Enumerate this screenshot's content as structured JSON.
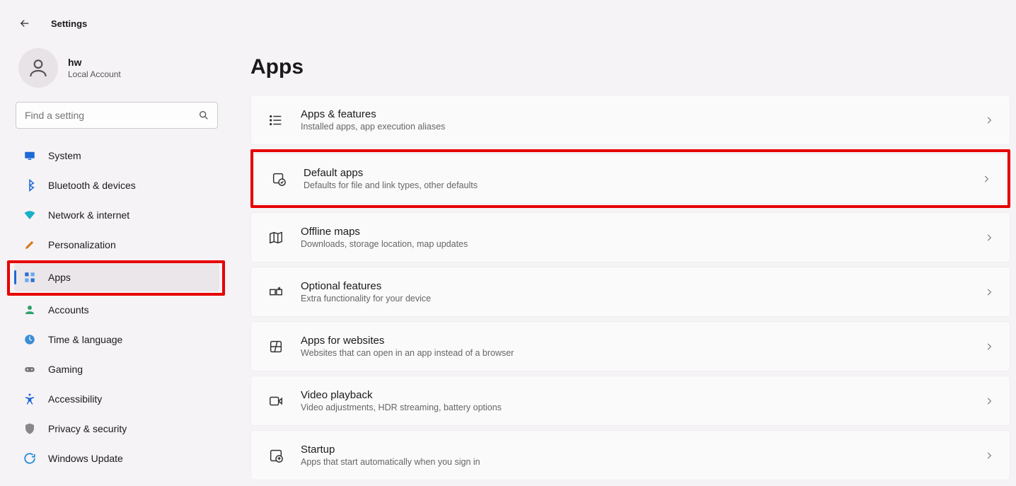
{
  "header": {
    "title": "Settings"
  },
  "user": {
    "name": "hw",
    "subtitle": "Local Account"
  },
  "search": {
    "placeholder": "Find a setting"
  },
  "nav": {
    "items": [
      {
        "label": "System"
      },
      {
        "label": "Bluetooth & devices"
      },
      {
        "label": "Network & internet"
      },
      {
        "label": "Personalization"
      },
      {
        "label": "Apps"
      },
      {
        "label": "Accounts"
      },
      {
        "label": "Time & language"
      },
      {
        "label": "Gaming"
      },
      {
        "label": "Accessibility"
      },
      {
        "label": "Privacy & security"
      },
      {
        "label": "Windows Update"
      }
    ]
  },
  "page": {
    "title": "Apps"
  },
  "cards": [
    {
      "title": "Apps & features",
      "subtitle": "Installed apps, app execution aliases"
    },
    {
      "title": "Default apps",
      "subtitle": "Defaults for file and link types, other defaults"
    },
    {
      "title": "Offline maps",
      "subtitle": "Downloads, storage location, map updates"
    },
    {
      "title": "Optional features",
      "subtitle": "Extra functionality for your device"
    },
    {
      "title": "Apps for websites",
      "subtitle": "Websites that can open in an app instead of a browser"
    },
    {
      "title": "Video playback",
      "subtitle": "Video adjustments, HDR streaming, battery options"
    },
    {
      "title": "Startup",
      "subtitle": "Apps that start automatically when you sign in"
    }
  ]
}
